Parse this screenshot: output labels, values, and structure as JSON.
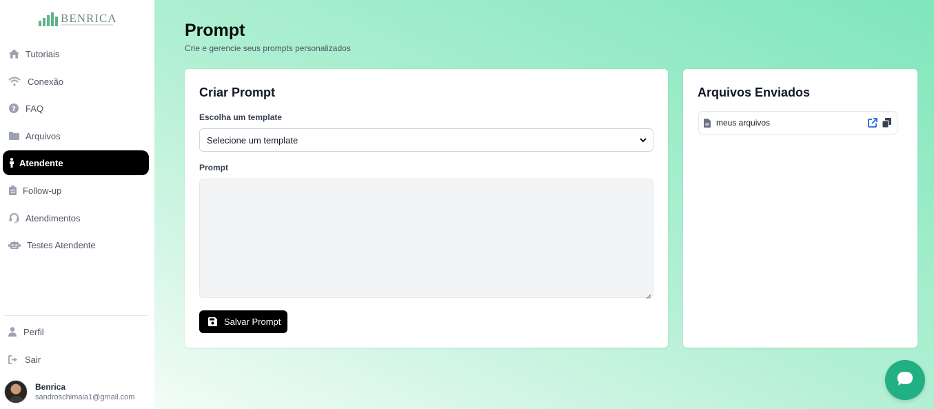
{
  "brand": {
    "name": "BENRICA"
  },
  "sidebar": {
    "items": [
      {
        "label": "Tutoriais",
        "icon": "home-icon"
      },
      {
        "label": "Conexão",
        "icon": "wifi-icon"
      },
      {
        "label": "FAQ",
        "icon": "question-icon"
      },
      {
        "label": "Arquivos",
        "icon": "folder-icon"
      },
      {
        "label": "Atendente",
        "icon": "person-icon",
        "active": true
      },
      {
        "label": "Follow-up",
        "icon": "clipboard-icon"
      },
      {
        "label": "Atendimentos",
        "icon": "headset-icon"
      },
      {
        "label": "Testes Atendente",
        "icon": "robot-icon"
      }
    ],
    "bottom": [
      {
        "label": "Perfil",
        "icon": "user-icon"
      },
      {
        "label": "Sair",
        "icon": "logout-icon"
      }
    ],
    "user": {
      "name": "Benrica",
      "email": "sandroschimaia1@gmail.com"
    }
  },
  "page": {
    "title": "Prompt",
    "subtitle": "Crie e gerencie seus prompts personalizados"
  },
  "create_card": {
    "title": "Criar Prompt",
    "template_label": "Escolha um template",
    "template_selected": "Selecione um template",
    "prompt_label": "Prompt",
    "prompt_value": "",
    "save_label": "Salvar Prompt"
  },
  "files_card": {
    "title": "Arquivos Enviados",
    "files": [
      {
        "name": "meus arquivos"
      }
    ]
  },
  "colors": {
    "accent": "#20b083",
    "active_nav": "#000000",
    "link_icon": "#2563eb"
  }
}
